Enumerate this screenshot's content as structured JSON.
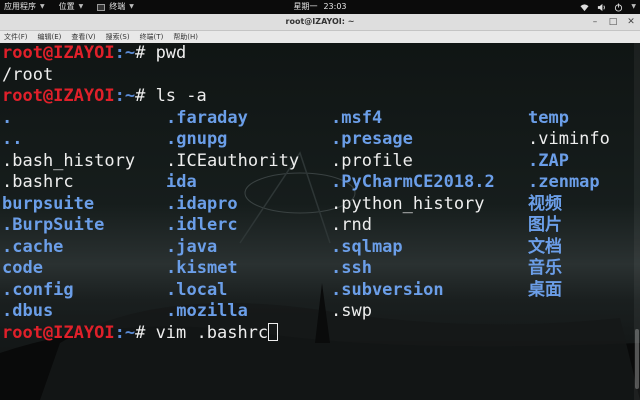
{
  "topbar": {
    "apps_menu": "应用程序",
    "places_menu": "位置",
    "terminal_menu": "终端",
    "day": "星期一",
    "time": "23:03",
    "wifi_icon": "wifi-icon",
    "volume_icon": "volume-icon",
    "power_icon": "power-icon"
  },
  "window": {
    "title": "root@IZAYOI: ~",
    "menus": [
      "文件(F)",
      "编辑(E)",
      "查看(V)",
      "搜索(S)",
      "终端(T)",
      "帮助(H)"
    ]
  },
  "terminal": {
    "prompt_user": "root@IZAYOI",
    "prompt_path": ":~",
    "prompt_symbol": "# ",
    "cmd1": "pwd",
    "out1": "/root",
    "cmd2": "ls -a",
    "cmd3": "vim .bashrc",
    "colors": {
      "user": "#e0202a",
      "dir": "#6b9ee8",
      "text": "#eeeeee"
    },
    "columns": [
      [
        {
          "name": ".",
          "dir": true
        },
        {
          "name": "..",
          "dir": true
        },
        {
          "name": ".bash_history",
          "dir": false
        },
        {
          "name": ".bashrc",
          "dir": false
        },
        {
          "name": "burpsuite",
          "dir": true
        },
        {
          "name": ".BurpSuite",
          "dir": true
        },
        {
          "name": ".cache",
          "dir": true
        },
        {
          "name": "code",
          "dir": true
        },
        {
          "name": ".config",
          "dir": true
        },
        {
          "name": ".dbus",
          "dir": true
        }
      ],
      [
        {
          "name": ".faraday",
          "dir": true
        },
        {
          "name": ".gnupg",
          "dir": true
        },
        {
          "name": ".ICEauthority",
          "dir": false
        },
        {
          "name": "ida",
          "dir": true
        },
        {
          "name": ".idapro",
          "dir": true
        },
        {
          "name": ".idlerc",
          "dir": true
        },
        {
          "name": ".java",
          "dir": true
        },
        {
          "name": ".kismet",
          "dir": true
        },
        {
          "name": ".local",
          "dir": true
        },
        {
          "name": ".mozilla",
          "dir": true
        }
      ],
      [
        {
          "name": ".msf4",
          "dir": true
        },
        {
          "name": ".presage",
          "dir": true
        },
        {
          "name": ".profile",
          "dir": false
        },
        {
          "name": ".PyCharmCE2018.2",
          "dir": true
        },
        {
          "name": ".python_history",
          "dir": false
        },
        {
          "name": ".rnd",
          "dir": false
        },
        {
          "name": ".sqlmap",
          "dir": true
        },
        {
          "name": ".ssh",
          "dir": true
        },
        {
          "name": ".subversion",
          "dir": true
        },
        {
          "name": ".swp",
          "dir": false
        }
      ],
      [
        {
          "name": "temp",
          "dir": true
        },
        {
          "name": ".viminfo",
          "dir": false
        },
        {
          "name": ".ZAP",
          "dir": true
        },
        {
          "name": ".zenmap",
          "dir": true
        },
        {
          "name": "视频",
          "dir": true
        },
        {
          "name": "图片",
          "dir": true
        },
        {
          "name": "文档",
          "dir": true
        },
        {
          "name": "音乐",
          "dir": true
        },
        {
          "name": "桌面",
          "dir": true
        }
      ]
    ]
  }
}
